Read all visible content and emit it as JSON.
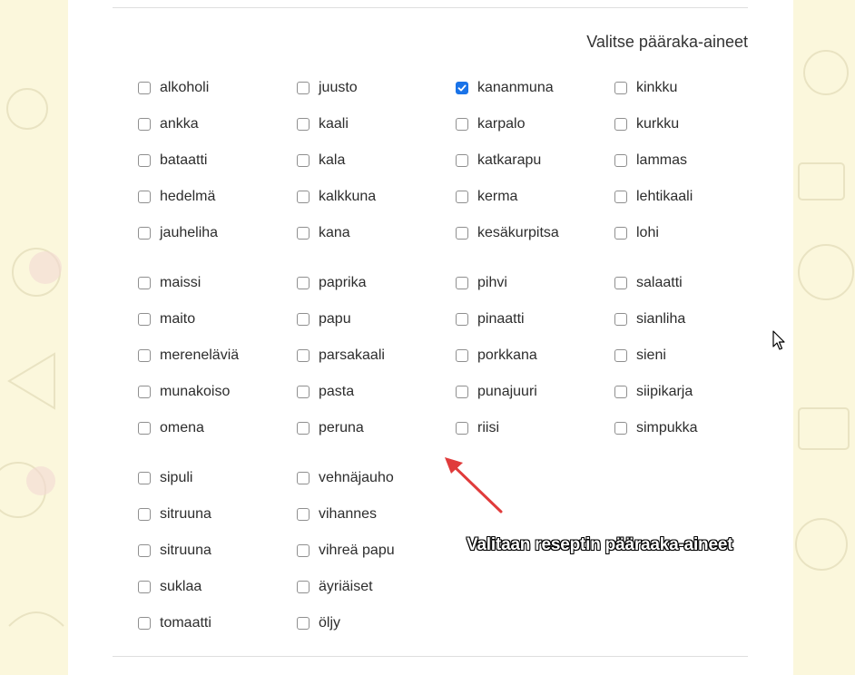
{
  "form": {
    "title": "Valitse pääraka-aineet",
    "options": [
      [
        "alkoholi",
        "juusto",
        "kananmuna",
        "kinkku"
      ],
      [
        "ankka",
        "kaali",
        "karpalo",
        "kurkku"
      ],
      [
        "bataatti",
        "kala",
        "katkarapu",
        "lammas"
      ],
      [
        "hedelmä",
        "kalkkuna",
        "kerma",
        "lehtikaali"
      ],
      [
        "jauheliha",
        "kana",
        "kesäkurpitsa",
        "lohi"
      ],
      [
        "maissi",
        "paprika",
        "pihvi",
        "salaatti"
      ],
      [
        "maito",
        "papu",
        "pinaatti",
        "sianliha"
      ],
      [
        "mereneläviä",
        "parsakaali",
        "porkkana",
        "sieni"
      ],
      [
        "munakoiso",
        "pasta",
        "punajuuri",
        "siipikarja"
      ],
      [
        "omena",
        "peruna",
        "riisi",
        "simpukka"
      ],
      [
        "sipuli",
        "vehnäjauho"
      ],
      [
        "sitruuna",
        "vihannes"
      ],
      [
        "sitruuna",
        "vihreä papu"
      ],
      [
        "suklaa",
        "äyriäiset"
      ],
      [
        "tomaatti",
        "öljy"
      ]
    ],
    "checked": [
      "kananmuna"
    ]
  },
  "annotation": {
    "text": "Valitaan reseptin pääraaka-aineet",
    "arrow_color": "#e03b3b"
  },
  "colors": {
    "page_background": "#fbf7dc",
    "panel_background": "#ffffff",
    "checkbox_checked": "#1a73e8"
  }
}
